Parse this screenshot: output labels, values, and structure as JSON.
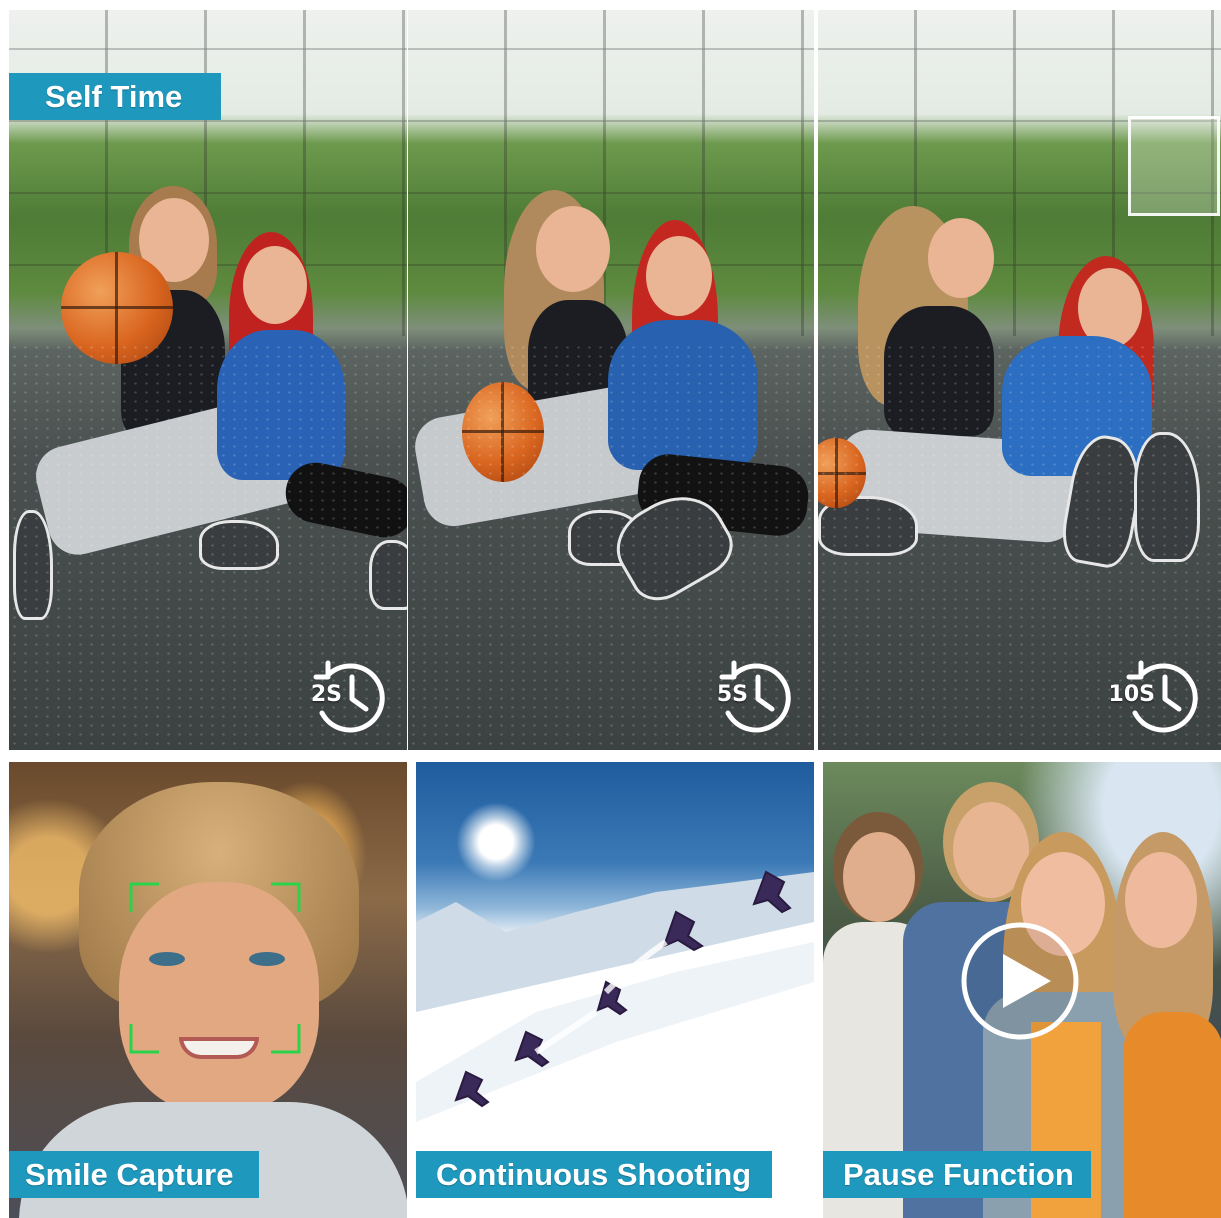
{
  "self_timer": {
    "label": "Self Time",
    "timers": [
      "2S",
      "5S",
      "10S"
    ]
  },
  "features": [
    {
      "label": "Smile Capture",
      "icon": "face-frame-icon"
    },
    {
      "label": "Continuous Shooting",
      "icon": "skier-sequence-icon"
    },
    {
      "label": "Pause Function",
      "icon": "play-icon"
    }
  ],
  "colors": {
    "label_background": "#1e98bd",
    "label_text": "#ffffff",
    "face_frame": "#2bd34a"
  }
}
